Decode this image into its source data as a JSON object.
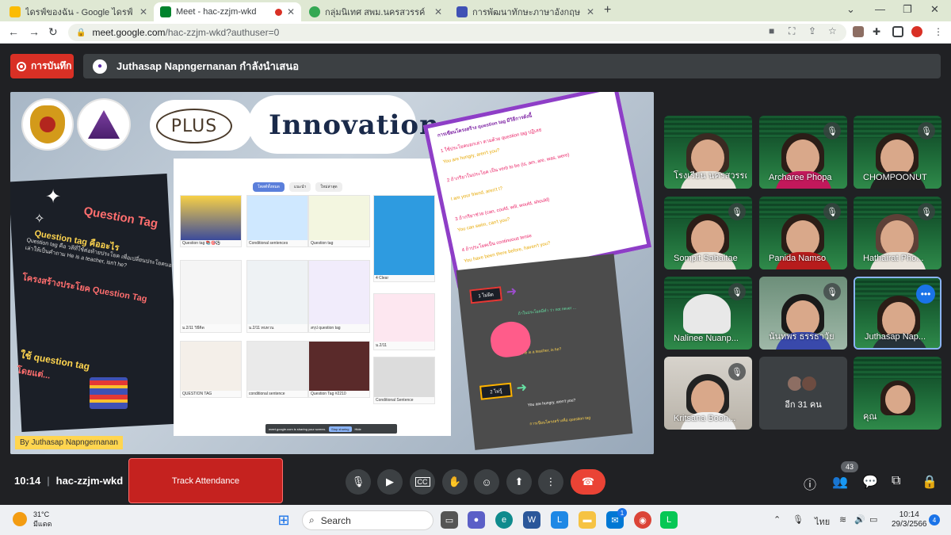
{
  "browser": {
    "tabs": [
      {
        "title": "ไดรฟ์ของฉัน - Google ไดรฟ์",
        "favicon": "drive-icon",
        "color": "#fbbc04"
      },
      {
        "title": "Meet - hac-zzjm-wkd",
        "favicon": "meet-icon",
        "color": "#00832d"
      },
      {
        "title": "กลุ่มนิเทศ สพม.นครสวรรค์",
        "favicon": "globe-icon",
        "color": "#34a853"
      },
      {
        "title": "การพัฒนาทักษะภาษาอังกฤษ English",
        "favicon": "forms-icon",
        "color": "#3f51b5"
      }
    ],
    "url_host": "meet.google.com",
    "url_path": "/hac-zzjm-wkd?authuser=0"
  },
  "meet": {
    "record_label": "การบันทึก",
    "presenting_text": "Juthasap Napngernanan กำลังนำเสนอ",
    "meeting_time": "10:14",
    "meeting_code": "hac-zzjm-wkd",
    "track_attendance": "Track Attendance",
    "people_count": "43"
  },
  "slide": {
    "plus": "PLUS",
    "title": "Innovation",
    "qt_title": "Question Tag",
    "qt_sub": "Question tag คืออะไร",
    "qt_body": "Question tag คือ วลีที่ใช้ต่อท้ายประโยค เพื่อเปลี่ยนประโยคบอกเล่าให้เป็นคำถาม He is a teacher, isn't he?",
    "qt_h2": "โครงสร้างประโยค Question Tag",
    "qt_h3": "ใช้ question tag",
    "qt_h4": "โดยแต่...",
    "padlet_tabs": [
      "โพสต์ทั้งหมด",
      "แนะนำ",
      "ใหม่ล่าสุด"
    ],
    "padlet_cards": [
      {
        "cap": "Question tag 📚🎯⚽"
      },
      {
        "cap": "Conditional sentences"
      },
      {
        "cap": "Question tag"
      },
      {
        "cap": "4 Clear"
      },
      {
        "cap": "ม.2/11 วิธีคิด"
      },
      {
        "cap": "ม.2/11 ทบทวน"
      },
      {
        "cap": "สรุป question tag"
      },
      {
        "cap": "ม.2/11"
      },
      {
        "cap": "QUESTION TAG"
      },
      {
        "cap": "conditional sentence"
      },
      {
        "cap": "Question Tag #2210"
      },
      {
        "cap": "Conditional Sentence"
      }
    ],
    "share_text": "meet.google.com is sharing your screen.",
    "stop_sharing": "Stop sharing",
    "hide": "Hide",
    "note_lines": [
      "การเขียนโครงสร้าง question tag มีวิธีการดังนี้",
      "1 ใช้ประโยคบอกเล่า ตามด้วย question tag ปฏิเสธ",
      "You are hungry, aren't you?",
      "2 ถ้ากริยาในประโยค เป็น verb to be (is, am, are, was, were)",
      "I am your friend, aren't I?",
      "3 ถ้ากริยาช่วย (can, could, will, would, should)",
      "You can swim, can't you?",
      "4 ถ้าประโยคเป็น continuous tense",
      "You have been there before, haven't you?"
    ],
    "box1": "1 ไม่ผิด",
    "box2": "2 ไม่รู้",
    "green_lines": [
      "ถ้าในประโยคมีคำ ว่า not never ...",
      "He is a teacher, is he?",
      "You are hungry, aren't you?",
      "การเขียนโครงสร้างคือ question tag"
    ],
    "byline": "By Juthasap Napngernanan"
  },
  "participants": [
    {
      "name": "โรงเรียน นครสวรรค์"
    },
    {
      "name": "Archaree Phopa"
    },
    {
      "name": "CHOMPOONUT"
    },
    {
      "name": "Sompit Sabaitae"
    },
    {
      "name": "Panida Namso"
    },
    {
      "name": "Hathairat Pho..."
    },
    {
      "name": "Nalinee Nuanp..."
    },
    {
      "name": "นันทพร ธรรธาวัย"
    },
    {
      "name": "Juthasap Nap..."
    },
    {
      "name": "Kritsana Boon..."
    },
    {
      "name": "อีก 31 คน"
    },
    {
      "name": "คุณ"
    }
  ],
  "taskbar": {
    "temp": "31°C",
    "weather": "มีแดด",
    "search": "Search",
    "lang": "ไทย",
    "time": "10:14",
    "date": "29/3/2566",
    "notif_count": "4",
    "mail_badge": "1"
  }
}
